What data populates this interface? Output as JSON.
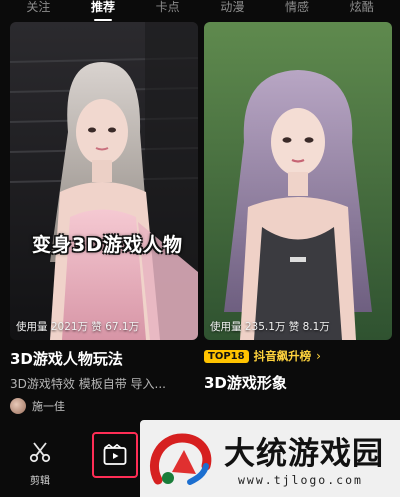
{
  "tabs": [
    {
      "label": "关注"
    },
    {
      "label": "推荐"
    },
    {
      "label": "卡点"
    },
    {
      "label": "动漫"
    },
    {
      "label": "情感"
    },
    {
      "label": "炫酷"
    }
  ],
  "cards": [
    {
      "overlay_title": "变身3D游戏人物",
      "stats": "使用量 2021万  赞 67.1万",
      "title": "3D游戏人物玩法",
      "description": "3D游戏特效 模板自带 导入...",
      "author": "施一佳"
    },
    {
      "stats": "使用量 235.1万  赞 8.1万",
      "rank_badge": "TOP18",
      "rank_text": "抖音飙升榜",
      "rank_arrow": "›",
      "title": "3D游戏形象"
    }
  ],
  "toolbar": {
    "edit_label": "剪辑"
  },
  "watermark": {
    "name": "大统游戏园",
    "url": "www.tjlogo.com"
  },
  "colors": {
    "accent": "#ff2d55",
    "rank_badge": "#ffc300",
    "background": "#0b0b0b"
  }
}
